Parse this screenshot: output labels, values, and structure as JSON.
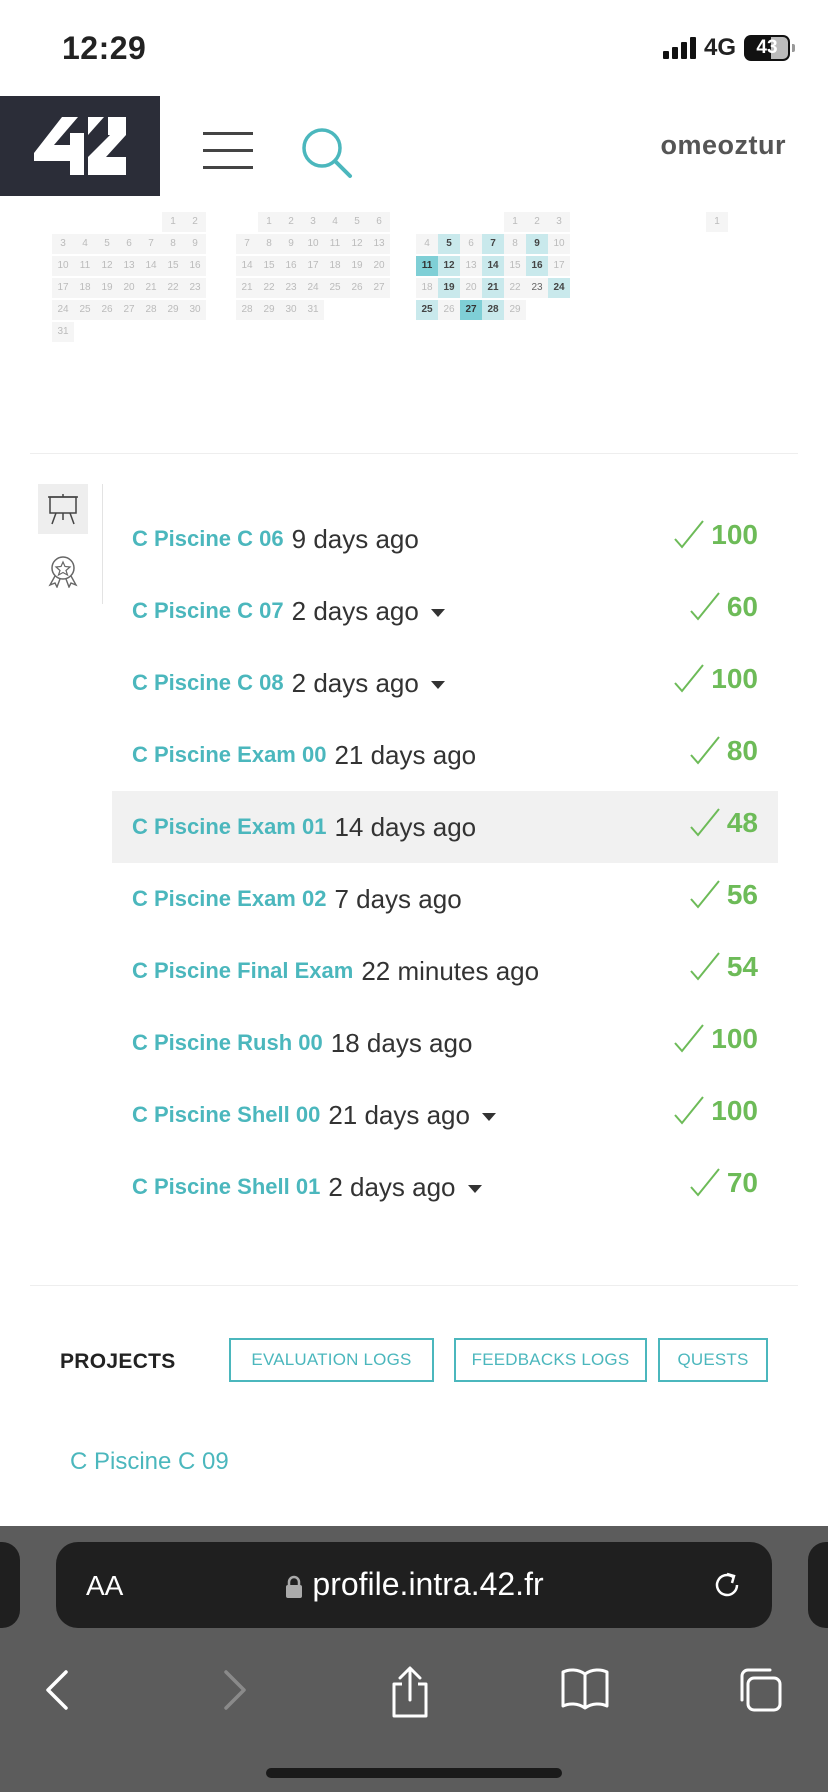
{
  "status_bar": {
    "time": "12:29",
    "network": "4G",
    "battery": "43"
  },
  "header": {
    "logo_text": "42",
    "username": "omeoztur"
  },
  "calendar": {
    "months": [
      {
        "rows": [
          [
            "",
            "",
            "",
            "",
            "",
            "1",
            "2"
          ],
          [
            "3",
            "4",
            "5",
            "6",
            "7",
            "8",
            "9"
          ],
          [
            "10",
            "11",
            "12",
            "13",
            "14",
            "15",
            "16"
          ],
          [
            "17",
            "18",
            "19",
            "20",
            "21",
            "22",
            "23"
          ],
          [
            "24",
            "25",
            "26",
            "27",
            "28",
            "29",
            "30"
          ],
          [
            "31"
          ]
        ]
      },
      {
        "rows": [
          [
            "",
            "1",
            "2",
            "3",
            "4",
            "5",
            "6"
          ],
          [
            "7",
            "8",
            "9",
            "10",
            "11",
            "12",
            "13"
          ],
          [
            "14",
            "15",
            "16",
            "17",
            "18",
            "19",
            "20"
          ],
          [
            "21",
            "22",
            "23",
            "24",
            "25",
            "26",
            "27"
          ],
          [
            "28",
            "29",
            "30",
            "31"
          ]
        ]
      },
      {
        "rows": [
          [
            "",
            "",
            "",
            "",
            "1",
            "2",
            "3"
          ],
          [
            "4",
            "5",
            "6",
            "7",
            "8",
            "9",
            "10"
          ],
          [
            "11",
            "12",
            "13",
            "14",
            "15",
            "16",
            "17"
          ],
          [
            "18",
            "19",
            "20",
            "21",
            "22",
            "23",
            "24"
          ],
          [
            "25",
            "26",
            "27",
            "28",
            "29"
          ]
        ],
        "light": [
          "5",
          "7",
          "9",
          "12",
          "14",
          "16",
          "19",
          "21",
          "24",
          "25",
          "28"
        ],
        "strong": [
          "11",
          "27"
        ]
      },
      {
        "rows": [
          [
            "1"
          ]
        ]
      }
    ]
  },
  "projects_list": [
    {
      "name": "C Piscine C 06",
      "time": "9 days ago",
      "grade": "100",
      "caret": false
    },
    {
      "name": "C Piscine C 07",
      "time": "2 days ago",
      "grade": "60",
      "caret": true
    },
    {
      "name": "C Piscine C 08",
      "time": "2 days ago",
      "grade": "100",
      "caret": true
    },
    {
      "name": "C Piscine Exam 00",
      "time": "21 days ago",
      "grade": "80",
      "caret": false
    },
    {
      "name": "C Piscine Exam 01",
      "time": "14 days ago",
      "grade": "48",
      "caret": false,
      "highlight": true
    },
    {
      "name": "C Piscine Exam 02",
      "time": "7 days ago",
      "grade": "56",
      "caret": false
    },
    {
      "name": "C Piscine Final Exam",
      "time": "22 minutes ago",
      "grade": "54",
      "caret": false
    },
    {
      "name": "C Piscine Rush 00",
      "time": "18 days ago",
      "grade": "100",
      "caret": false
    },
    {
      "name": "C Piscine Shell 00",
      "time": "21 days ago",
      "grade": "100",
      "caret": true
    },
    {
      "name": "C Piscine Shell 01",
      "time": "2 days ago",
      "grade": "70",
      "caret": true
    }
  ],
  "projects_section": {
    "title": "PROJECTS",
    "evaluation_logs": "EVALUATION LOGS",
    "feedbacks_logs": "FEEDBACKS LOGS",
    "quests": "QUESTS",
    "current_project": "C Piscine C 09"
  },
  "browser": {
    "aa_label": "AA",
    "url": "profile.intra.42.fr"
  },
  "colors": {
    "accent": "#4bb7bd",
    "grade_green": "#6dbb58",
    "logo_bg": "#2b2d38"
  }
}
